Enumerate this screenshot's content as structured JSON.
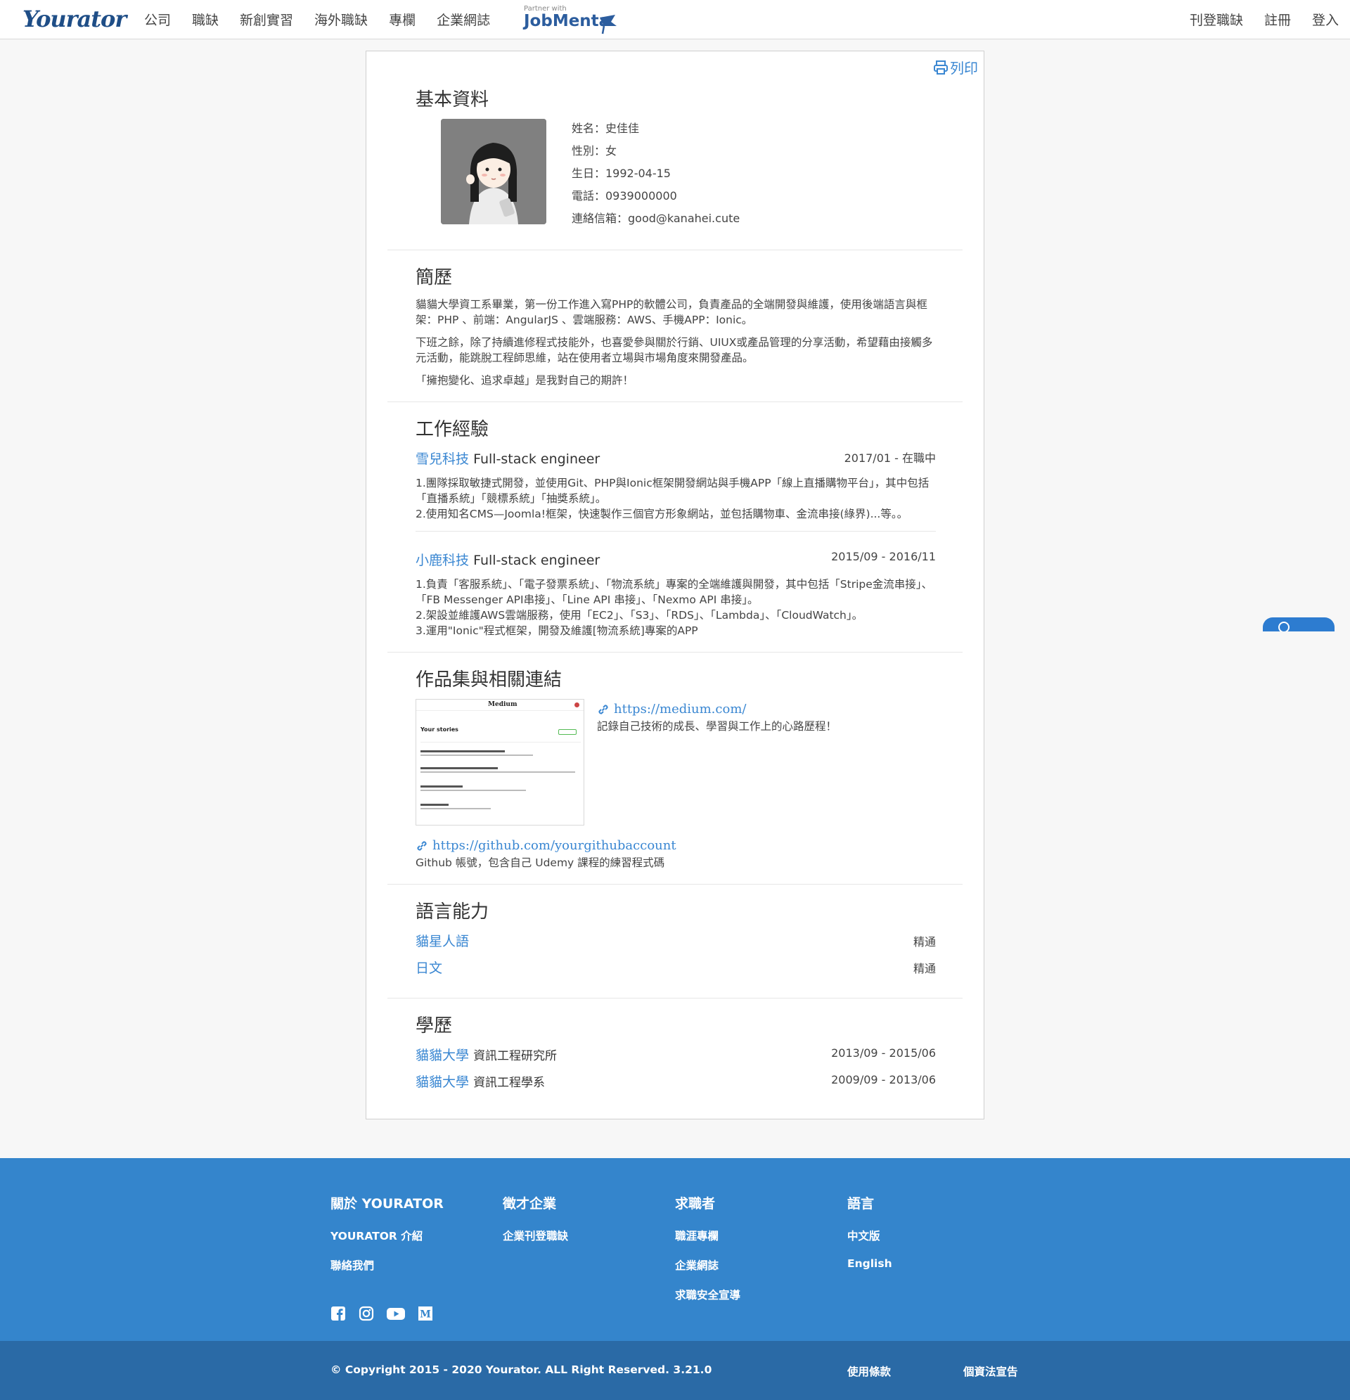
{
  "nav": {
    "logo": "Yourator",
    "links": [
      "公司",
      "職缺",
      "新創實習",
      "海外職缺",
      "專欄",
      "企業網誌"
    ],
    "partner_small": "Partner with",
    "partner_brand": "JobMenta",
    "right": [
      "刊登職缺",
      "註冊",
      "登入"
    ]
  },
  "resume": {
    "print_label": "列印",
    "basic": {
      "title": "基本資料",
      "name": "姓名：史佳佳",
      "gender": "性別：女",
      "birthday": "生日：1992-04-15",
      "phone": "電話：0939000000",
      "email": "連絡信箱：good@kanahei.cute"
    },
    "bio": {
      "title": "簡歷",
      "p1": "貓貓大學資工系畢業，第一份工作進入寫PHP的軟體公司，負責產品的全端開發與維護，使用後端語言與框架：PHP 、前端：AngularJS 、雲端服務：AWS、手機APP：Ionic。",
      "p2": "下班之餘，除了持續進修程式技能外，也喜愛參與關於行銷、UIUX或產品管理的分享活動，希望藉由接觸多元活動，能跳脫工程師思維，站在使用者立場與市場角度來開發產品。",
      "p3": "「擁抱變化、追求卓越」是我對自己的期許！"
    },
    "work": {
      "title": "工作經驗",
      "jobs": [
        {
          "company": "雪兒科技",
          "role": "Full-stack engineer",
          "date": "2017/01 - 在職中",
          "lines": [
            "1.團隊採取敏捷式開發，並使用Git、PHP與Ionic框架開發網站與手機APP「線上直播購物平台」，其中包括「直播系統」「競標系統」「抽獎系統」。",
            "2.使用知名CMS—Joomla!框架，快速製作三個官方形象網站，並包括購物車、金流串接(綠界)...等。。"
          ]
        },
        {
          "company": "小鹿科技",
          "role": "Full-stack engineer",
          "date": "2015/09 - 2016/11",
          "lines": [
            "1.負責「客服系統」、「電子發票系統」、「物流系統」專案的全端維護與開發，其中包括「Stripe金流串接」、「FB Messenger API串接」、「Line API 串接」、「Nexmo API 串接」。",
            "2.架設並維護AWS雲端服務，使用「EC2」、「S3」、「RDS」、「Lambda」、「CloudWatch」。",
            "3.運用\"Ionic\"程式框架，開發及維護[物流系統]專案的APP"
          ]
        }
      ]
    },
    "portfolio": {
      "title": "作品集與相關連結",
      "items": [
        {
          "url": "https://medium.com/",
          "desc": "記錄自己技術的成長、學習與工作上的心路歷程！"
        },
        {
          "url": "https://github.com/yourgithubaccount",
          "desc": "Github 帳號，包含自己 Udemy 課程的練習程式碼"
        }
      ],
      "thumb": {
        "brand": "Medium",
        "heading": "Your stories"
      }
    },
    "languages": {
      "title": "語言能力",
      "items": [
        {
          "name": "貓星人語",
          "level": "精通"
        },
        {
          "name": "日文",
          "level": "精通"
        }
      ]
    },
    "education": {
      "title": "學歷",
      "items": [
        {
          "school": "貓貓大學",
          "dept": "資訊工程研究所",
          "date": "2013/09 - 2015/06"
        },
        {
          "school": "貓貓大學",
          "dept": "資訊工程學系",
          "date": "2009/09 - 2013/06"
        }
      ]
    }
  },
  "footer": {
    "cols": [
      {
        "title": "關於 YOURATOR",
        "items": [
          "YOURATOR 介紹",
          "聯絡我們"
        ]
      },
      {
        "title": "徵才企業",
        "items": [
          "企業刊登職缺"
        ]
      },
      {
        "title": "求職者",
        "items": [
          "職涯專欄",
          "企業網誌",
          "求職安全宣導"
        ]
      },
      {
        "title": "語言",
        "items": [
          "中文版",
          "English"
        ]
      }
    ],
    "social_icons": [
      "facebook-icon",
      "instagram-icon",
      "youtube-icon",
      "medium-icon"
    ],
    "copyright": "© Copyright 2015 - 2020 Yourator. ALL Right Reserved. 3.21.0",
    "terms": "使用條款",
    "privacy": "個資法宣告"
  },
  "colors": {
    "accent": "#3a87d2",
    "footer": "#3485cc",
    "footer_bottom": "#2a6aa6",
    "logo": "#1f4e87"
  }
}
